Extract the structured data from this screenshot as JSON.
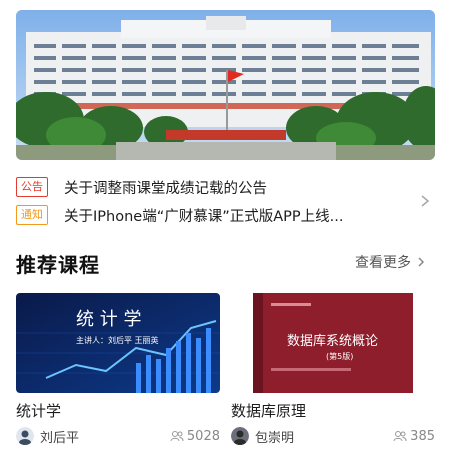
{
  "banner": {
    "image": "campus-building-photo"
  },
  "notices": [
    {
      "tag": "公告",
      "tag_color": "#e33b2f",
      "text": "关于调整雨课堂成绩记载的公告"
    },
    {
      "tag": "通知",
      "tag_color": "#f29a1a",
      "text": "关于IPhone端“广财慕课”正式版APP上线..."
    }
  ],
  "section": {
    "title": "推荐课程",
    "more_label": "查看更多"
  },
  "courses": [
    {
      "name": "统计学",
      "teacher": "刘后平",
      "learners": "5028",
      "cover_title": "统 计 学",
      "cover_lecturers": "主讲人：刘后平 王丽英"
    },
    {
      "name": "数据库原理",
      "teacher": "包崇明",
      "learners": "385",
      "cover_title": "数据库系统概论",
      "cover_edition": "(第5版)"
    }
  ],
  "icons": {
    "arrow": "chevron-right-icon",
    "learners": "people-icon"
  }
}
